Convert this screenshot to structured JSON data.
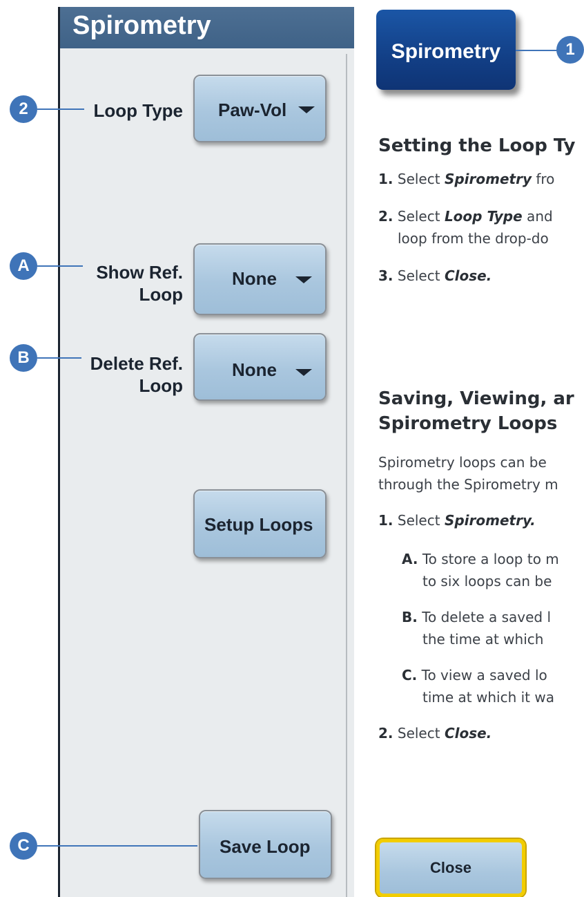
{
  "panel": {
    "title": "Spirometry",
    "loop_type": {
      "label": "Loop Type",
      "value": "Paw-Vol"
    },
    "show_ref_loop": {
      "label_line1": "Show Ref.",
      "label_line2": "Loop",
      "value": "None"
    },
    "delete_ref_loop": {
      "label_line1": "Delete Ref.",
      "label_line2": "Loop",
      "value": "None"
    },
    "setup_loops_label": "Setup Loops",
    "save_loop_label": "Save Loop"
  },
  "callouts": {
    "one": "1",
    "two": "2",
    "a": "A",
    "b": "B",
    "c": "C"
  },
  "spirometry_button_label": "Spirometry",
  "section1": {
    "heading": "Setting the Loop Ty",
    "steps": [
      {
        "num": "1.",
        "pre": "Select ",
        "em": "Spirometry",
        "post": " fro"
      },
      {
        "num": "2.",
        "pre": "Select ",
        "em": "Loop Type",
        "post": " and",
        "line2": "loop from the drop-do"
      },
      {
        "num": "3.",
        "pre": "Select ",
        "em": "Close.",
        "post": ""
      }
    ]
  },
  "section2": {
    "heading_line1": "Saving, Viewing, ar",
    "heading_line2": "Spirometry Loops",
    "intro_line1": "Spirometry loops can be",
    "intro_line2": "through the Spirometry m",
    "step1": {
      "num": "1.",
      "pre": "Select ",
      "em": "Spirometry."
    },
    "substeps": [
      {
        "letter": "A.",
        "line1": "To store a loop to m",
        "line2": "to six loops can be"
      },
      {
        "letter": "B.",
        "line1": "To delete a saved l",
        "line2": "the time at which"
      },
      {
        "letter": "C.",
        "line1": "To view a saved lo",
        "line2": "time at which it wa"
      }
    ],
    "step2": {
      "num": "2.",
      "pre": "Select ",
      "em": "Close."
    }
  },
  "close_label": "Close",
  "colors": {
    "header": "#446892",
    "accent": "#3f74b8",
    "close_border": "#f2cd00"
  }
}
